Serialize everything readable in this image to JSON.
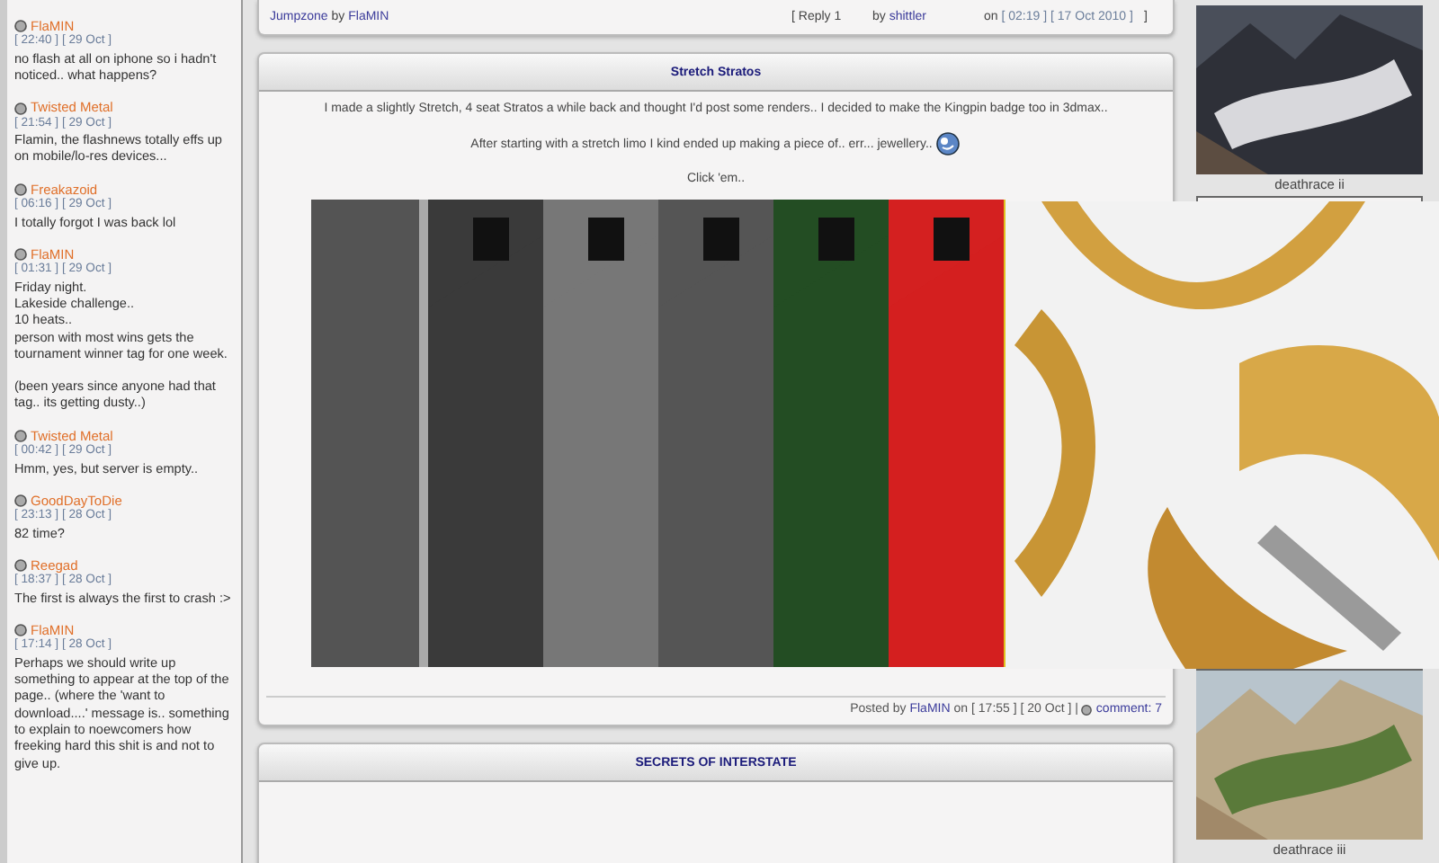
{
  "shoutbox": [
    {
      "name": "FlaMIN",
      "time": "[ 22:40 ]",
      "date": "[ 29 Oct ]",
      "paragraphs": [
        [
          "no flash at all on iphone so i hadn't noticed.. what happens?"
        ]
      ]
    },
    {
      "name": "Twisted Metal",
      "time": "[ 21:54 ]",
      "date": "[ 29 Oct ]",
      "paragraphs": [
        [
          "Flamin, the flashnews totally effs up on mobile/lo-res devices..."
        ]
      ]
    },
    {
      "name": "Freakazoid",
      "time": "[ 06:16 ]",
      "date": "[ 29 Oct ]",
      "paragraphs": [
        [
          "I totally forgot I was back lol"
        ]
      ]
    },
    {
      "name": "FlaMIN",
      "time": "[ 01:31 ]",
      "date": "[ 29 Oct ]",
      "paragraphs": [
        [
          "Friday night.",
          "Lakeside challenge..",
          "10 heats..",
          "person with most wins gets the tournament winner tag for one week."
        ],
        [
          "(been years since anyone had that tag.. its getting dusty..)"
        ]
      ]
    },
    {
      "name": "Twisted Metal",
      "time": "[ 00:42 ]",
      "date": "[ 29 Oct ]",
      "paragraphs": [
        [
          "Hmm, yes, but server is empty.."
        ]
      ]
    },
    {
      "name": "GoodDayToDie",
      "time": "[ 23:13 ]",
      "date": "[ 28 Oct ]",
      "paragraphs": [
        [
          "82 time?"
        ]
      ]
    },
    {
      "name": "Reegad",
      "time": "[ 18:37 ]",
      "date": "[ 28 Oct ]",
      "paragraphs": [
        [
          "The first is always the first to crash :>"
        ]
      ]
    },
    {
      "name": "FlaMIN",
      "time": "[ 17:14 ]",
      "date": "[ 28 Oct ]",
      "paragraphs": [
        [
          "Perhaps we should write up something to appear at the top of the page.. (where the 'want to download....' message is.. something to explain to noewcomers how freeking hard this shit is and not to give up."
        ]
      ]
    }
  ],
  "topics": [
    {
      "title": "Jumpzone",
      "by_word": "by",
      "author": "FlaMIN",
      "reply": "[ Reply 1",
      "last_by": "by",
      "last_author": "shittler",
      "on": "on",
      "time": "[ 02:19 ]",
      "date": "[ 17 Oct 2010 ]",
      "close": "]"
    }
  ],
  "post": {
    "title": "Stretch Stratos",
    "paragraphs": [
      "I made a slightly Stretch, 4 seat Stratos a while back and thought I'd post some renders.. I decided to make the Kingpin badge too in 3dmax..",
      "After starting with a stretch limo I kind ended up making a piece of.. err... jewellery..",
      "Click 'em.."
    ],
    "footer": {
      "posted_by": "Posted by",
      "author": "FlaMIN",
      "when": "on [ 17:55 ] [ 20 Oct ] |",
      "comments": "comment: 7"
    }
  },
  "next_panel": {
    "title": "SECRETS OF INTERSTATE"
  },
  "maps": [
    {
      "caption": "deathrace ii",
      "kind": "snow"
    },
    {
      "caption": "deathrace iii",
      "kind": "grass"
    }
  ]
}
